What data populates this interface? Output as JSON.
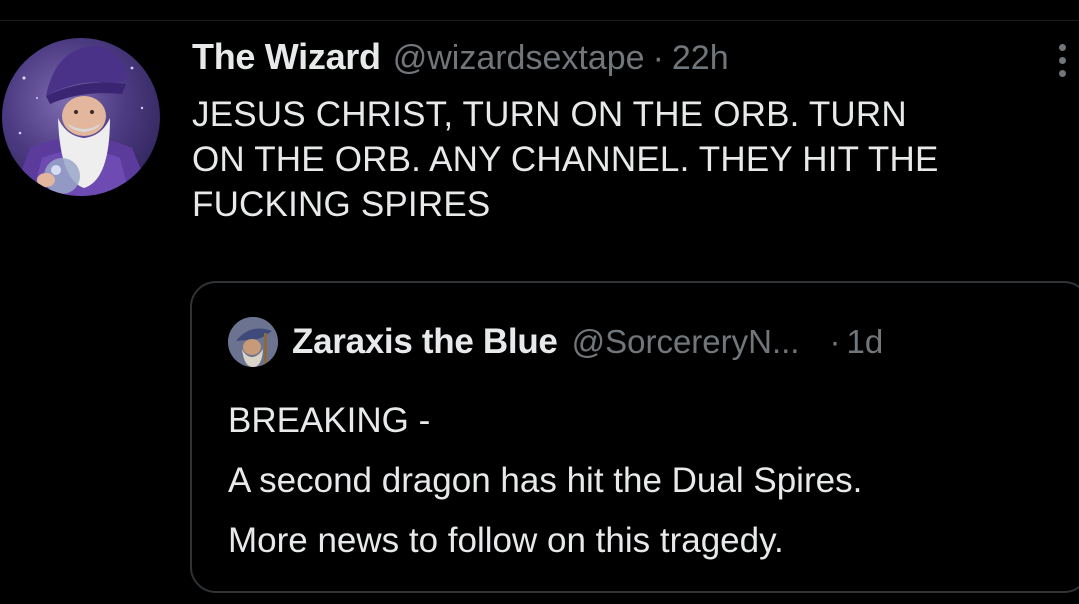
{
  "tweet": {
    "display_name": "The Wizard",
    "handle": "@wizardsextape",
    "separator": "·",
    "timestamp": "22h",
    "avatar_icon": "wizard-avatar",
    "text_lines": [
      "JESUS CHRIST, TURN ON THE ORB. TURN",
      "ON THE ORB. ANY CHANNEL. THEY HIT THE",
      "FUCKING SPIRES"
    ],
    "more_icon": "vertical-ellipsis-icon"
  },
  "quoted_tweet": {
    "display_name": "Zaraxis the Blue",
    "handle": "@SorcereryN...",
    "separator": "·",
    "timestamp": "1d",
    "avatar_icon": "wizard-avatar-small",
    "text_lines": [
      "BREAKING -",
      "A second dragon has hit the Dual Spires.",
      "More news to follow on this tragedy."
    ]
  },
  "colors": {
    "background": "#000000",
    "primary_text": "#e7e9ea",
    "secondary_text": "#71767b",
    "border": "#2f3336"
  }
}
